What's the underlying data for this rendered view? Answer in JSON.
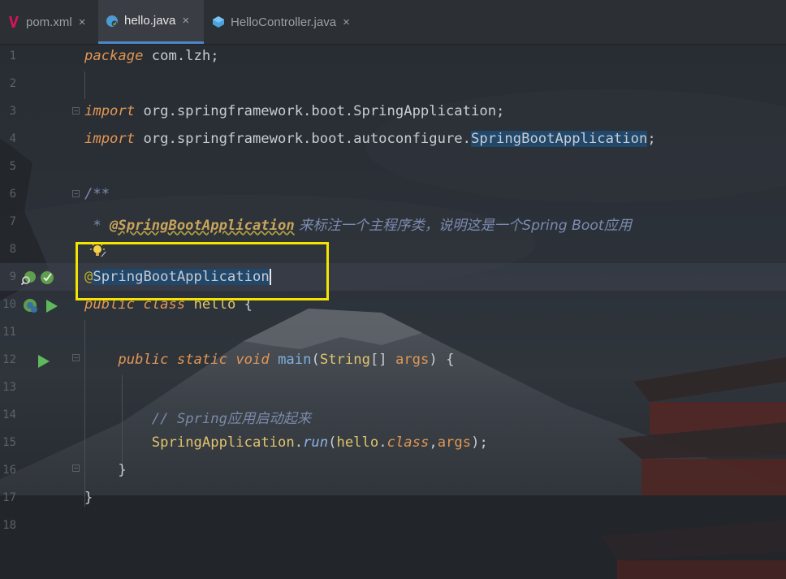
{
  "tabs": [
    {
      "label": "pom.xml",
      "icon": "maven-icon",
      "active": false
    },
    {
      "label": "hello.java",
      "icon": "java-class-icon",
      "active": true
    },
    {
      "label": "HelloController.java",
      "icon": "java-class-icon",
      "active": false
    }
  ],
  "tab_close_glyph": "×",
  "line_numbers": [
    "1",
    "2",
    "3",
    "4",
    "5",
    "6",
    "7",
    "8",
    "9",
    "10",
    "11",
    "12",
    "13",
    "14",
    "15",
    "16",
    "17",
    "18"
  ],
  "code": {
    "l1_kw": "package",
    "l1_rest": " com.lzh;",
    "l3_kw": "import",
    "l3_rest": " org.springframework.boot.SpringApplication;",
    "l4_kw": "import",
    "l4_pre": " org.springframework.boot.autoconfigure.",
    "l4_hl": "SpringBootApplication",
    "l4_end": ";",
    "l6": "/**",
    "l7_star": " * ",
    "l7_tag": "@SpringBootApplication",
    "l7_text": " 来标注一个主程序类，说明这是一个Spring Boot应用",
    "l9_at": "@",
    "l9_ann": "SpringBootApplication",
    "l10_kw1": "public",
    "l10_kw2": "class",
    "l10_name": "hello",
    "l10_brace": " {",
    "l12_kw1": "public",
    "l12_kw2": "static",
    "l12_kw3": "void",
    "l12_name": "main",
    "l12_p1": "(",
    "l12_type": "String",
    "l12_arr": "[] ",
    "l12_arg": "args",
    "l12_end": ") {",
    "l14": "// Spring应用启动起来",
    "l15_cls": "SpringApplication",
    "l15_dot": ".",
    "l15_run": "run",
    "l15_p": "(",
    "l15_hello": "hello",
    "l15_dot2": ".",
    "l15_class": "class",
    "l15_comma": ",",
    "l15_args": "args",
    "l15_end": ");",
    "l16": "}",
    "l17": "}"
  },
  "colors": {
    "keyword": "#e19653",
    "annotation_highlight": "#21476a",
    "callout_box": "#f5e400",
    "active_tab_underline": "#4a88c7"
  }
}
